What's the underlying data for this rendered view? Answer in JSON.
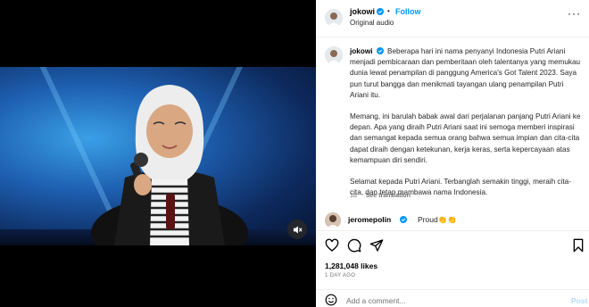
{
  "post": {
    "username": "jokowi",
    "dot": "•",
    "follow_label": "Follow",
    "audio_label": "Original audio",
    "more_label": "···"
  },
  "caption": {
    "username": "jokowi",
    "paragraphs": [
      "Beberapa hari ini nama penyanyi Indonesia Putri Ariani menjadi pembicaraan dan pemberitaan oleh talentanya yang memukau dunia lewat penampilan di panggung America's Got Talent 2023. Saya pun turut bangga dan menikmati tayangan ulang penampilan Putri Ariani itu.",
      "Memang, ini barulah babak awal dari perjalanan panjang Putri Ariani ke depan. Apa yang diraih Putri Ariani saat ini semoga memberi inspirasi dan semangat kepada semua orang bahwa semua impian dan cita-cita dapat diraih dengan ketekunan, kerja keras, serta kepercayaan atas kemampuan diri sendiri.",
      "Selamat kepada Putri Ariani. Terbanglah semakin tinggi, meraih cita-cita, dan tetap mambawa nama Indonesia."
    ],
    "time": "1d",
    "see_translation": "See translation"
  },
  "comments": [
    {
      "username": "jeromepolin",
      "text": "Proud👏👏"
    }
  ],
  "actions": {
    "likes": "1,281,048 likes",
    "time_ago": "1 DAY AGO"
  },
  "add_comment": {
    "placeholder": "Add a comment...",
    "post_label": "Post"
  },
  "colors": {
    "accent": "#0095f6",
    "verified": "#0095f6",
    "post_disabled": "#b3dbff"
  }
}
